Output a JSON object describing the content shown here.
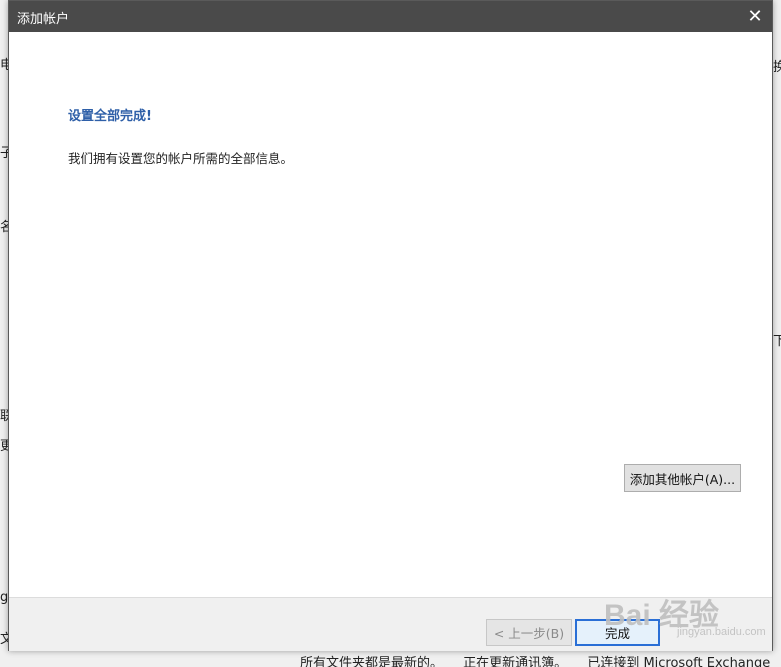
{
  "dialog": {
    "title": "添加帐户",
    "close_label": "✕",
    "heading": "设置全部完成!",
    "description": "我们拥有设置您的帐户所需的全部信息。",
    "add_other_label": "添加其他帐户(A)...",
    "back_label": "< 上一步(B)",
    "finish_label": "完成"
  },
  "background": {
    "left_glyphs": [
      "电",
      "子",
      "名",
      "联",
      "更",
      "g",
      "文"
    ],
    "right_glyphs": [
      "换",
      "下"
    ],
    "status_bar": [
      "所有文件夹都是最新的。",
      "正在更新通讯簿。",
      "已连接到 Microsoft Exchange"
    ]
  },
  "watermark": {
    "text": "Bai 经验",
    "sub": "jingyan.baidu.com"
  },
  "colors": {
    "titlebar": "#4a4a4a",
    "heading": "#2e5fa8",
    "finish_border": "#2a6fd6"
  }
}
